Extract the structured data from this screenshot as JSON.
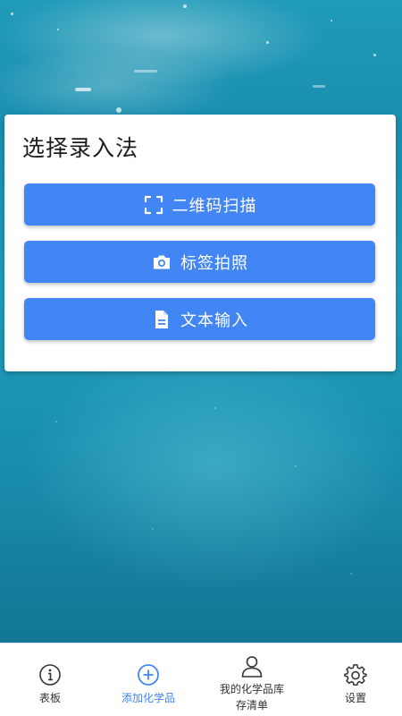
{
  "card": {
    "title": "选择录入法",
    "buttons": [
      {
        "label": "二维码扫描",
        "icon": "qr-scan-icon"
      },
      {
        "label": "标签拍照",
        "icon": "camera-icon"
      },
      {
        "label": "文本输入",
        "icon": "document-icon"
      }
    ]
  },
  "bottom_nav": {
    "items": [
      {
        "label": "表板",
        "icon": "info-icon",
        "active": false
      },
      {
        "label": "添加化学品",
        "icon": "add-circle-icon",
        "active": true
      },
      {
        "label_line1": "我的化学品库",
        "label_line2": "存清单",
        "icon": "person-icon",
        "active": false
      },
      {
        "label": "设置",
        "icon": "gear-icon",
        "active": false
      }
    ]
  },
  "colors": {
    "accent": "#4285f4",
    "card_bg": "#ffffff",
    "nav_text": "#333333",
    "water_blue": "#1b8fb0"
  }
}
